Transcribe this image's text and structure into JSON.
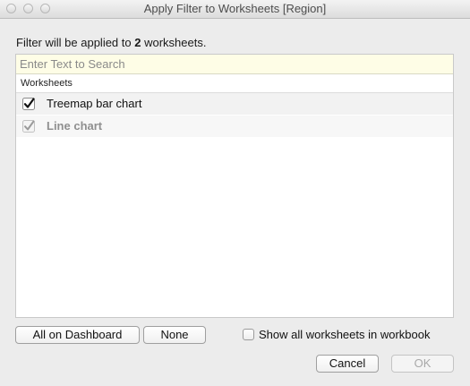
{
  "window": {
    "title": "Apply Filter to Worksheets [Region]"
  },
  "info": {
    "prefix": "Filter will be applied to ",
    "count": "2",
    "suffix": " worksheets."
  },
  "search": {
    "placeholder": "Enter Text to Search",
    "value": ""
  },
  "list": {
    "header": "Worksheets",
    "items": [
      {
        "label": "Treemap bar chart",
        "checked": true,
        "enabled": true
      },
      {
        "label": "Line chart",
        "checked": true,
        "enabled": false
      }
    ]
  },
  "buttons": {
    "all_on_dashboard": "All on Dashboard",
    "none": "None",
    "cancel": "Cancel",
    "ok": "OK"
  },
  "show_all": {
    "label": "Show all worksheets in workbook",
    "checked": false
  }
}
